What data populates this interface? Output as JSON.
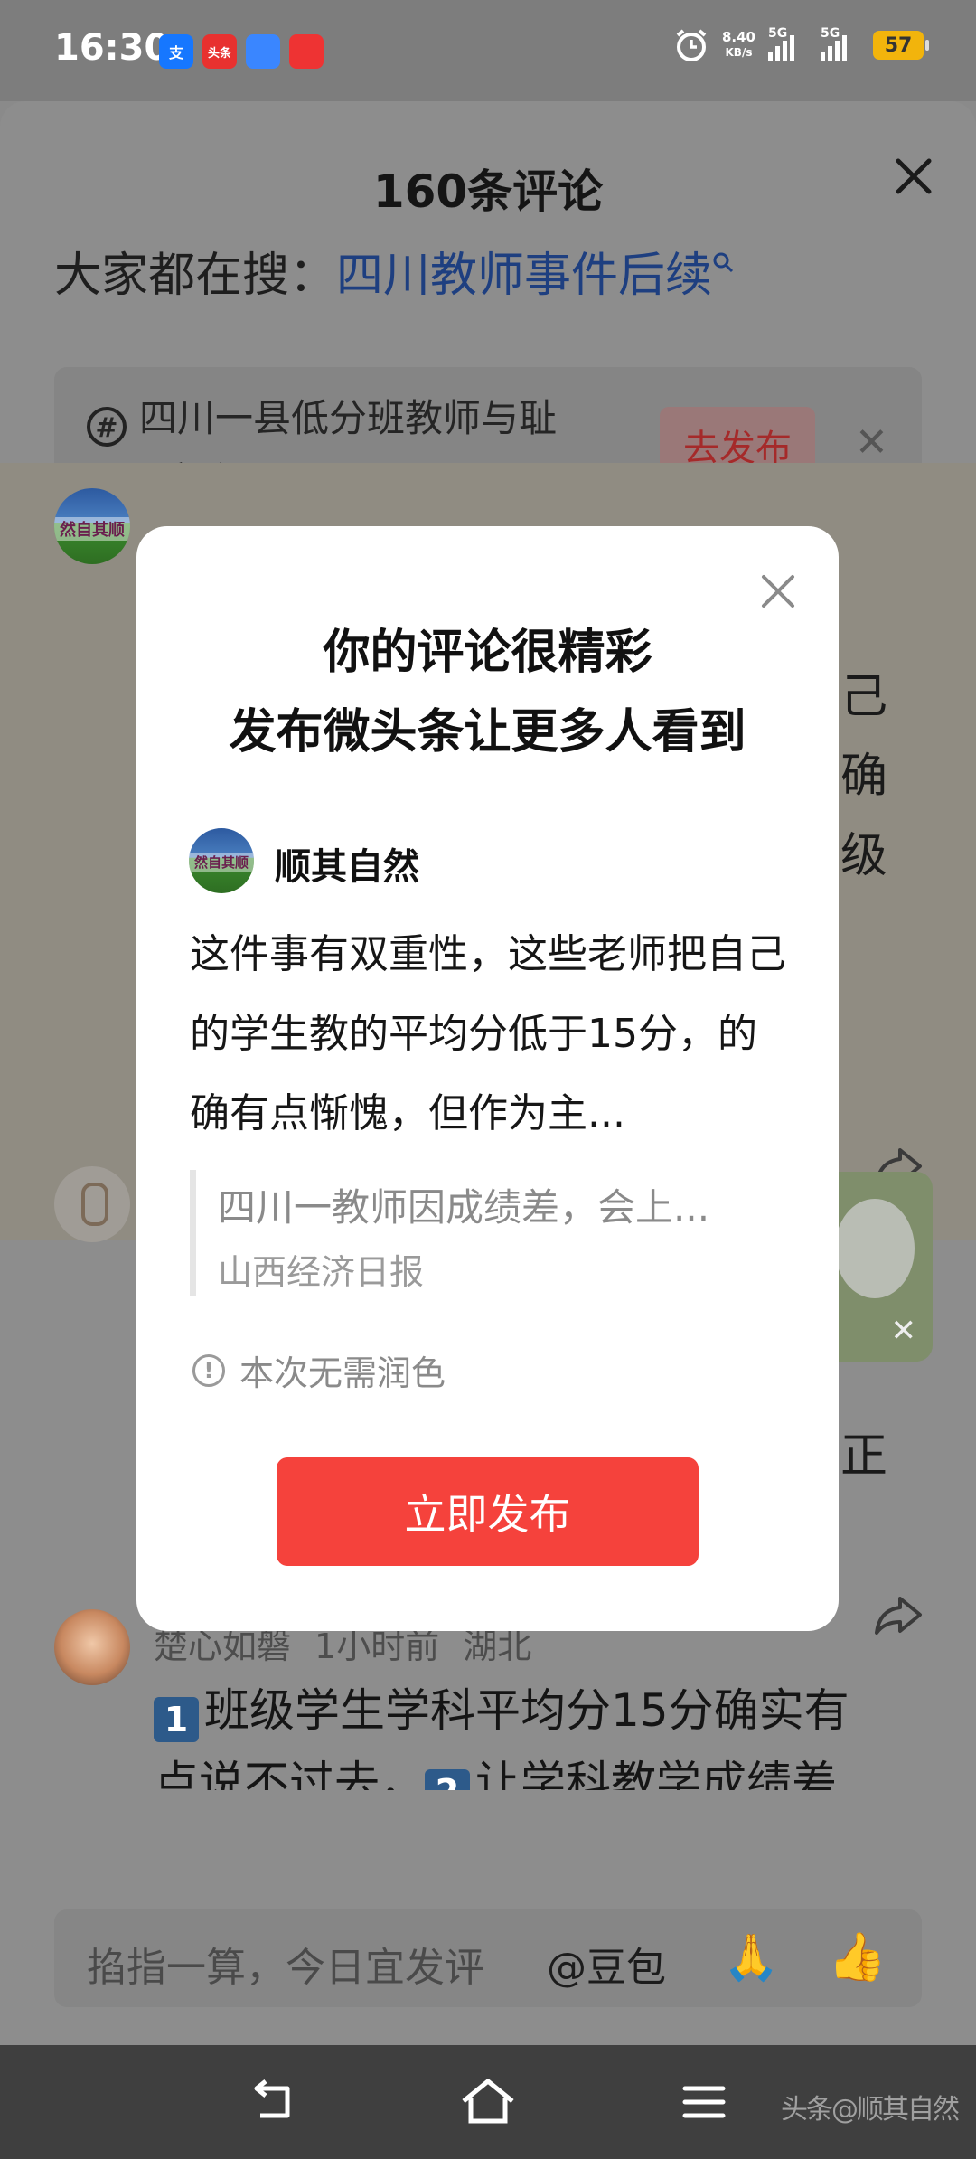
{
  "status_bar": {
    "time": "16:30",
    "apps": [
      {
        "name": "alipay",
        "label": "支",
        "color": "#1677ff"
      },
      {
        "name": "toutiao",
        "label": "头条",
        "color": "#e8312f"
      },
      {
        "name": "files",
        "label": "",
        "color": "#3a86ff"
      },
      {
        "name": "stocks",
        "label": "",
        "color": "#e33"
      }
    ],
    "net_speed": "8.40",
    "net_unit": "KB/s",
    "sig1": "5G",
    "sig2": "5G",
    "battery": "57"
  },
  "sheet": {
    "title": "160条评论",
    "trending_prefix": "大家都在搜：",
    "trending_keyword": "四川教师事件后续",
    "topic_text": "四川一县低分班教师与耻辱二字合影",
    "topic_button": "去发布"
  },
  "background_comments": {
    "c1_peek": [
      "己",
      "确",
      "级"
    ],
    "c2_peek": [
      "正"
    ],
    "c3": {
      "user": "楚心如磐",
      "time": "1小时前",
      "location": "湖北",
      "key1": "1",
      "text1": "班级学生学科平均分15分确实有",
      "line2_a": "点说不过去，",
      "key2": "2",
      "text2": "让学科教学成绩差"
    }
  },
  "input_bar": {
    "placeholder": "掐指一算，今日宜发评",
    "mention": "@豆包",
    "emoji1": "🙏",
    "emoji2": "👍"
  },
  "modal": {
    "title_line1": "你的评论很精彩",
    "title_line2": "发布微头条让更多人看到",
    "user_name": "顺其自然",
    "avatar_text": "然自其顺",
    "comment": "这件事有双重性，这些老师把自己的学生教的平均分低于15分，的确有点惭愧，但作为主...",
    "quote_title": "四川一教师因成绩差，会上...",
    "quote_source": "山西经济日报",
    "hint": "本次无需润色",
    "publish_button": "立即发布"
  },
  "nav_tag": "头条@顺其自然"
}
